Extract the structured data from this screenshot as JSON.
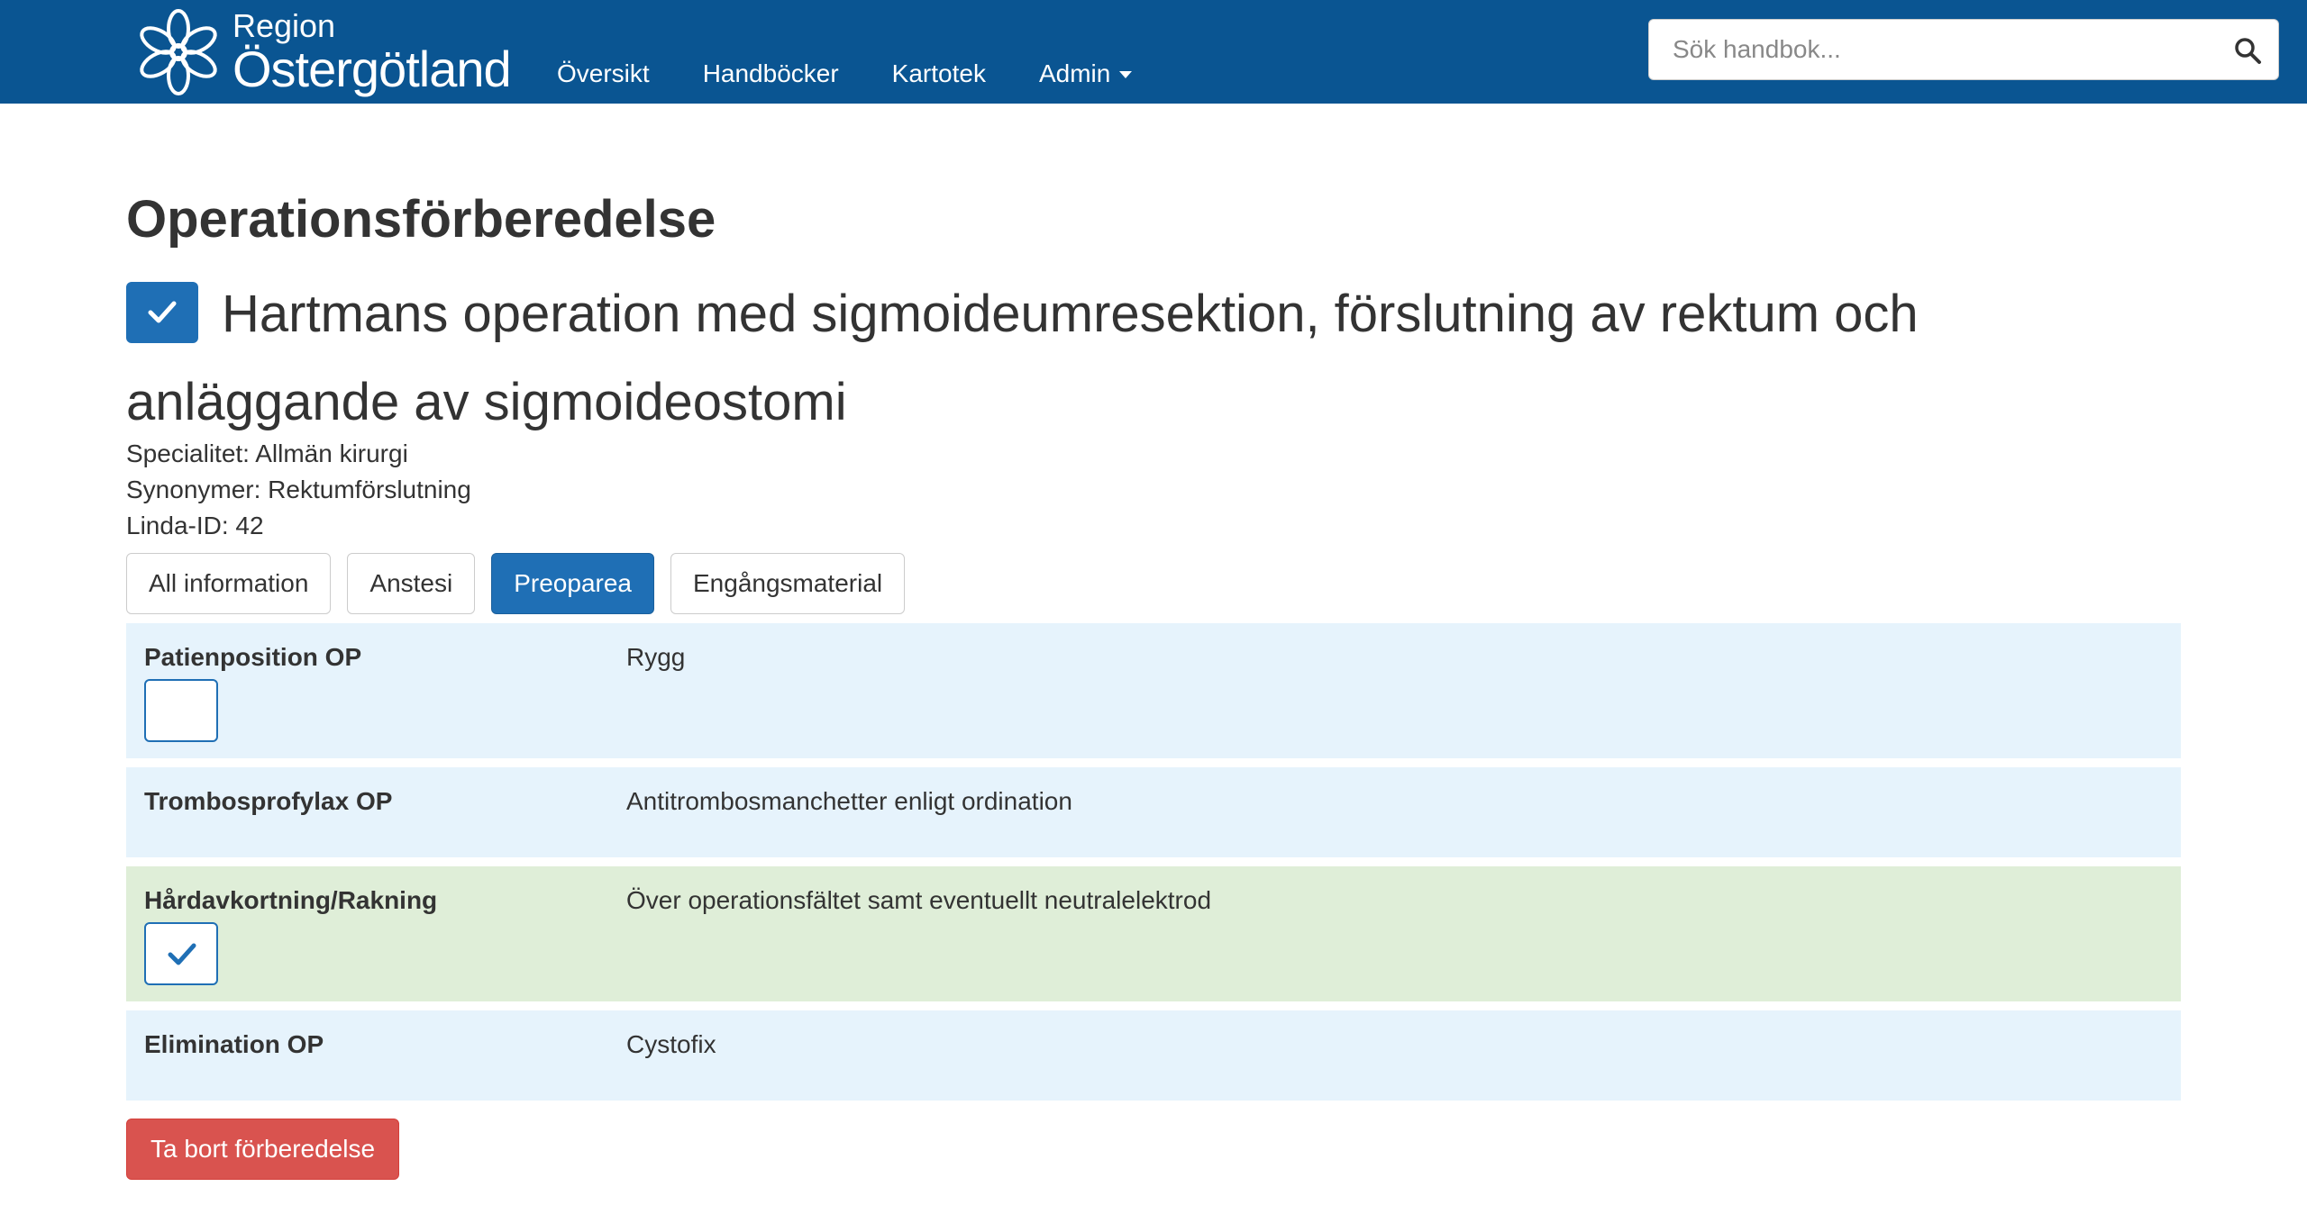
{
  "brand": {
    "region": "Region",
    "name": "Östergötland"
  },
  "nav": {
    "items": [
      "Översikt",
      "Handböcker",
      "Kartotek",
      "Admin"
    ]
  },
  "search": {
    "placeholder": "Sök handbok...",
    "value": ""
  },
  "page": {
    "title": "Operationsförberedelse",
    "procedure_checked": true,
    "procedure_title": "Hartmans operation med sigmoideumresektion, förslutning av rektum och anläggande av sigmoideostomi",
    "meta": {
      "specialty": "Specialitet: Allmän kirurgi",
      "synonyms": "Synonymer: Rektumförslutning",
      "linda_id": "Linda-ID: 42"
    }
  },
  "tabs": {
    "items": [
      "All information",
      "Anstesi",
      "Preoparea",
      "Engångsmaterial"
    ],
    "active": "Preoparea"
  },
  "rows": [
    {
      "label": "Patienposition OP",
      "value": "Rygg",
      "has_checkbox": true,
      "checked": false
    },
    {
      "label": "Trombosprofylax OP",
      "value": "Antitrombosmanchetter enligt ordination",
      "has_checkbox": false,
      "checked": false
    },
    {
      "label": "Hårdavkortning/Rakning",
      "value": "Över operationsfältet samt eventuellt neutralelektrod",
      "has_checkbox": true,
      "checked": true
    },
    {
      "label": "Elimination OP",
      "value": "Cystofix",
      "has_checkbox": false,
      "checked": false
    }
  ],
  "actions": {
    "delete_label": "Ta bort förberedelse"
  },
  "colors": {
    "navbar": "#0a5592",
    "primary": "#1f6fb5",
    "row_info": "#e6f3fc",
    "row_done": "#dfeed8",
    "danger": "#d9534f"
  }
}
